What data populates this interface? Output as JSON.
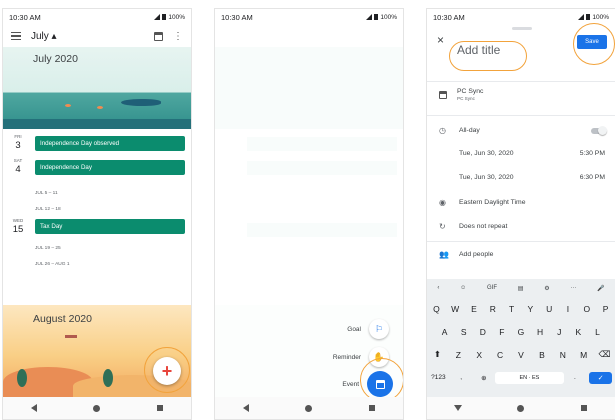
{
  "status": {
    "time": "10:30 AM",
    "battery": "100%"
  },
  "screen1": {
    "month_selector": "July ▴",
    "july_banner": "July 2020",
    "events": [
      {
        "dow": "FRI",
        "day": "3",
        "title": "Independence Day observed"
      },
      {
        "dow": "SAT",
        "day": "4",
        "title": "Independence Day"
      },
      {
        "dow": "WED",
        "day": "15",
        "title": "Tax Day"
      }
    ],
    "weeks": [
      "JUL 5 – 11",
      "JUL 12 – 18",
      "JUL 19 – 25",
      "JUL 26 – AUG 1"
    ],
    "aug_banner": "August 2020",
    "fab": "+"
  },
  "screen2": {
    "speed_dial": [
      {
        "label": "Goal",
        "icon": "flag-icon"
      },
      {
        "label": "Reminder",
        "icon": "reminder-hand-icon"
      },
      {
        "label": "Event",
        "icon": "calendar-icon"
      }
    ]
  },
  "screen3": {
    "close": "×",
    "save": "Save",
    "title_placeholder": "Add title",
    "calendar_name": "PC Sync",
    "calendar_sub": "PC Sync",
    "all_day": "All-day",
    "start_date": "Tue, Jun 30, 2020",
    "start_time": "5:30 PM",
    "end_date": "Tue, Jun 30, 2020",
    "end_time": "6:30 PM",
    "timezone": "Eastern Daylight Time",
    "repeat": "Does not repeat",
    "add_people": "Add people",
    "keyboard": {
      "toolbar": [
        "‹",
        "☺",
        "GIF",
        "▤",
        "⚙",
        "···",
        "🎤"
      ],
      "row1": [
        "Q",
        "W",
        "E",
        "R",
        "T",
        "Y",
        "U",
        "I",
        "O",
        "P"
      ],
      "row2": [
        "A",
        "S",
        "D",
        "F",
        "G",
        "H",
        "J",
        "K",
        "L"
      ],
      "row3": [
        "⬆",
        "Z",
        "X",
        "C",
        "V",
        "B",
        "N",
        "M",
        "⌫"
      ],
      "row4": [
        "?123",
        ",",
        "⊕",
        "EN · ES",
        ".",
        "✓"
      ]
    }
  },
  "colors": {
    "accent": "#1a73e8",
    "event_green": "#0b8c6e",
    "highlight_ring": "#f2a33c"
  }
}
